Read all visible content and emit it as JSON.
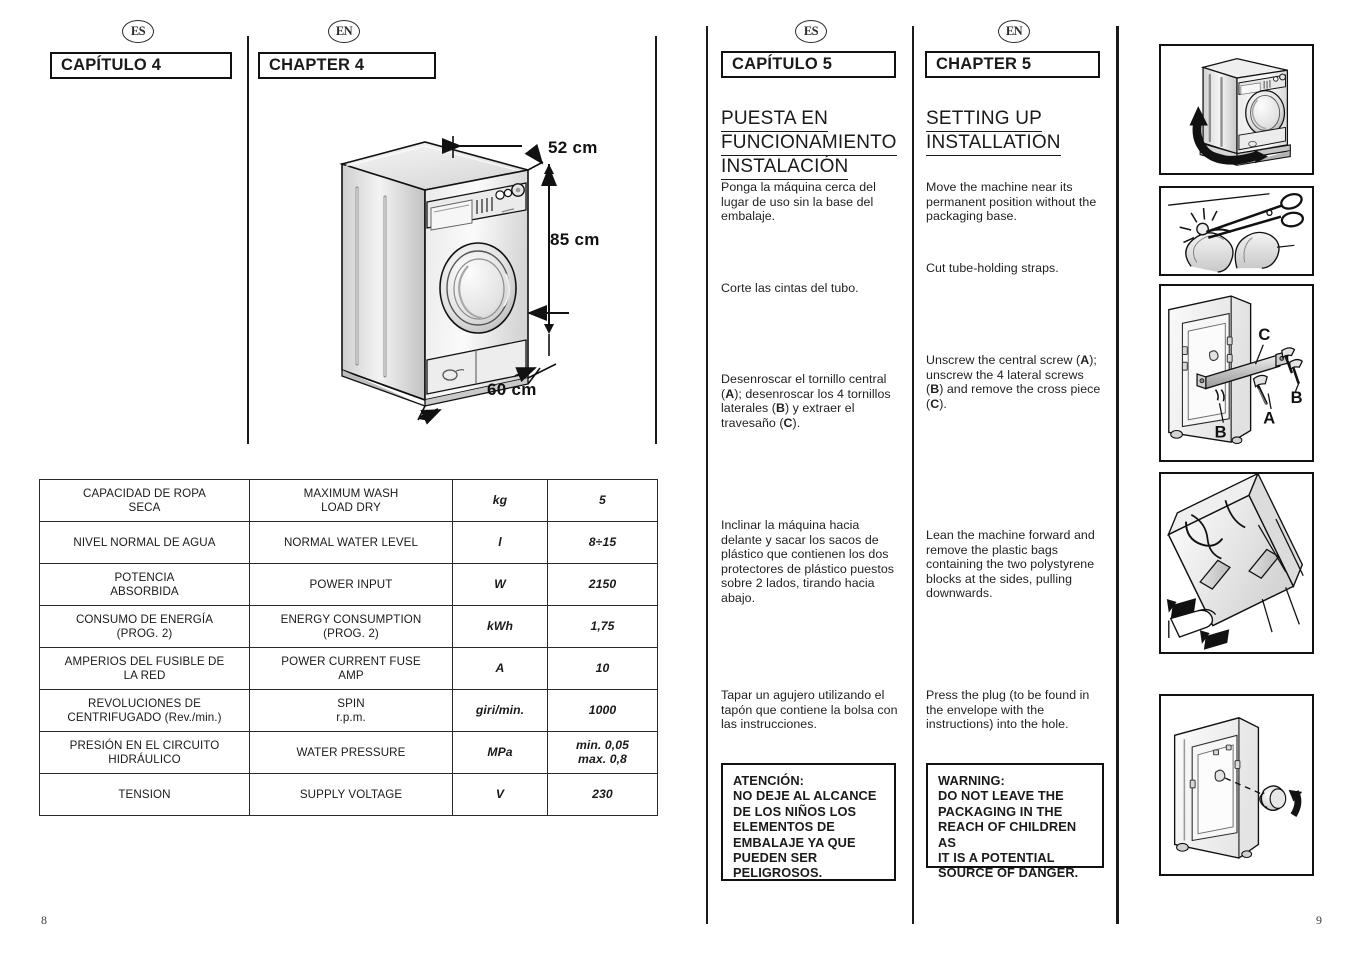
{
  "spread": {
    "left_page_number": "8",
    "right_page_number": "9"
  },
  "left_page": {
    "lang_badges": {
      "es": "ES",
      "en": "EN"
    },
    "chapter_es": "CAPÍTULO 4",
    "chapter_en": "CHAPTER 4",
    "diagram": {
      "name": "washing-machine-dimensions",
      "depth_label": "52 cm",
      "height_label": "85 cm",
      "width_label": "60 cm"
    },
    "spec_table": {
      "rows": [
        {
          "es": "CAPACIDAD DE ROPA\nSECA",
          "en": "MAXIMUM WASH\nLOAD DRY",
          "unit": "kg",
          "value": "5"
        },
        {
          "es": "NIVEL NORMAL DE AGUA",
          "en": "NORMAL WATER LEVEL",
          "unit": "l",
          "value": "8÷15"
        },
        {
          "es": "POTENCIA\nABSORBIDA",
          "en": "POWER INPUT",
          "unit": "W",
          "value": "2150"
        },
        {
          "es": "CONSUMO DE ENERGÍA\n(PROG. 2)",
          "en": "ENERGY CONSUMPTION\n(PROG. 2)",
          "unit": "kWh",
          "value": "1,75"
        },
        {
          "es": "AMPERIOS DEL FUSIBLE DE\nLA RED",
          "en": "POWER CURRENT FUSE\nAMP",
          "unit": "A",
          "value": "10"
        },
        {
          "es": "REVOLUCIONES DE\nCENTRIFUGADO (Rev./min.)",
          "en": "SPIN\nr.p.m.",
          "unit": "giri/min.",
          "value": "1000"
        },
        {
          "es": "PRESIÓN EN EL CIRCUITO\nHIDRÁULICO",
          "en": "WATER PRESSURE",
          "unit": "MPa",
          "value": "min. 0,05\nmax. 0,8"
        },
        {
          "es": "TENSION",
          "en": "SUPPLY VOLTAGE",
          "unit": "V",
          "value": "230"
        }
      ]
    }
  },
  "right_page": {
    "lang_badges": {
      "es": "ES",
      "en": "EN"
    },
    "es_column": {
      "chapter": "CAPÍTULO 5",
      "title_lines": [
        "PUESTA EN",
        "FUNCIONAMIENTO",
        "INSTALACIÓN"
      ],
      "paragraphs": [
        "Ponga la máquina cerca del lugar de uso sin la base del embalaje.",
        "Corte las cintas del tubo.",
        "Desenroscar el tornillo central (A); desenroscar los 4 tornillos laterales (B) y extraer el travesaño (C).",
        "Inclinar la máquina hacia delante y sacar los sacos de plástico que contienen los dos protectores de plástico puestos sobre 2 lados, tirando hacia abajo.",
        "Tapar un agujero utilizando el tapón que contiene la bolsa con las instrucciones."
      ],
      "warning": "ATENCIÓN:\nNO DEJE AL ALCANCE\nDE LOS NIÑOS LOS\nELEMENTOS DE\nEMBALAJE YA QUE\nPUEDEN SER\nPELIGROSOS."
    },
    "en_column": {
      "chapter": "CHAPTER 5",
      "title_lines": [
        "SETTING UP",
        "INSTALLATION"
      ],
      "paragraphs": [
        "Move the machine near its permanent position without the packaging base.",
        "Cut tube-holding straps.",
        "Unscrew the central screw (A); unscrew the 4 lateral screws (B) and remove the cross piece (C).",
        "Lean the machine forward and remove the plastic bags containing the two polystyrene blocks at the sides, pulling downwards.",
        "Press the plug (to be found in the envelope with the instructions) into the hole."
      ],
      "warning": "WARNING:\nDO NOT LEAVE THE\nPACKAGING IN THE\nREACH OF CHILDREN AS\nIT IS A POTENTIAL\nSOURCE OF DANGER."
    },
    "illustrations": [
      {
        "name": "illustration-remove-packaging-base",
        "callouts": []
      },
      {
        "name": "illustration-cut-tube-straps",
        "callouts": []
      },
      {
        "name": "illustration-unscrew-transit-bolts",
        "callouts": [
          "C",
          "B",
          "A",
          "B"
        ]
      },
      {
        "name": "illustration-lean-machine-remove-blocks",
        "callouts": []
      },
      {
        "name": "illustration-insert-hole-plug",
        "callouts": []
      }
    ]
  },
  "colors": {
    "ink": "#1a1a1a",
    "rule": "#2a2a2a",
    "paper": "#ffffff",
    "metal_light": "#f2f2f2",
    "metal_mid": "#d4d4d4",
    "metal_dark": "#9a9a9a"
  }
}
